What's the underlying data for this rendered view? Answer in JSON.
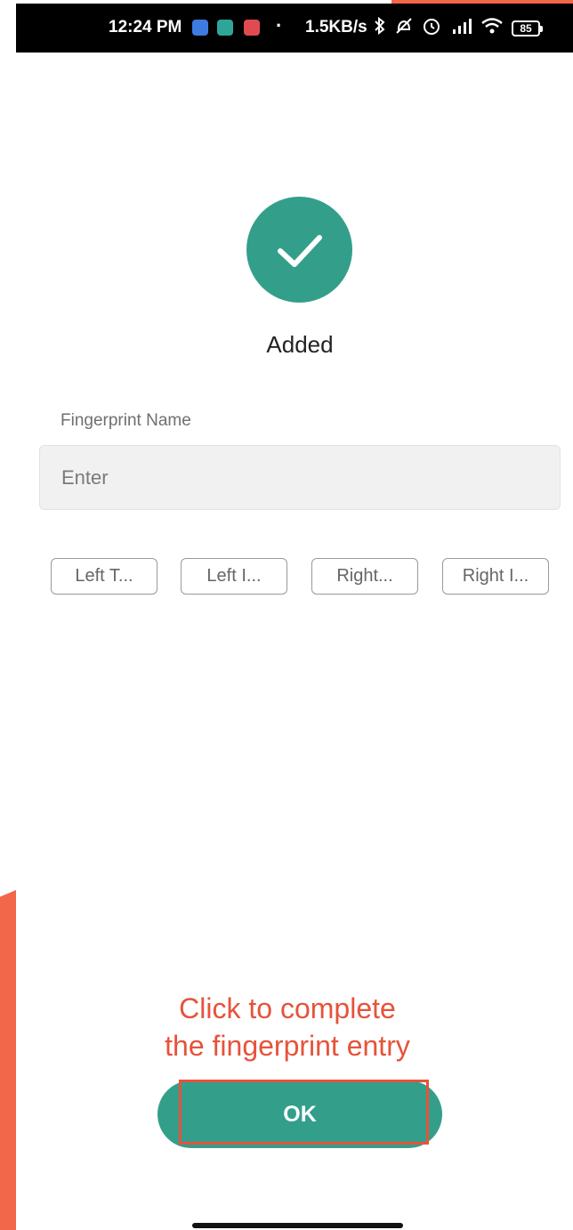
{
  "status_bar": {
    "time": "12:24 PM",
    "network_speed": "1.5KB/s",
    "battery_level": "85",
    "dot": "·",
    "icons": [
      "bluetooth-icon",
      "mute-icon",
      "alarm-icon",
      "hd-signal-icon",
      "wifi-icon",
      "battery-icon"
    ]
  },
  "success": {
    "title": "Added",
    "accent_color": "#339f8b"
  },
  "fingerprint_name": {
    "label": "Fingerprint Name",
    "placeholder": "Enter",
    "value": ""
  },
  "presets": [
    "Left T...",
    "Left I...",
    "Right...",
    "Right I..."
  ],
  "annotation": {
    "line1": "Click to complete",
    "line2": "the fingerprint entry",
    "color": "#e6533a"
  },
  "ok_button": {
    "label": "OK"
  }
}
